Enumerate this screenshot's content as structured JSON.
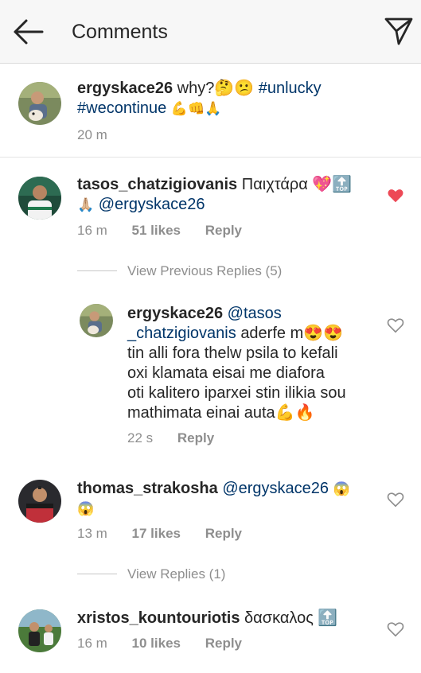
{
  "header": {
    "title": "Comments",
    "back_icon": "arrow-left-icon",
    "send_icon": "paper-plane-icon"
  },
  "caption": {
    "username": "ergyskace26",
    "text": "why?🤔😕",
    "hashtag1": "#unlucky",
    "hashtag2": "#wecontinue",
    "emojis": "💪👊🙏",
    "time": "20 m"
  },
  "comments": [
    {
      "username": "tasos_chatzigiovanis",
      "text": "Παιχτάρα 💖🔝",
      "emoji_line": "🙏🏼",
      "mention": "@ergyskace26",
      "time": "16 m",
      "likes": "51 likes",
      "reply": "Reply",
      "liked": true
    },
    {
      "username": "thomas_strakosha",
      "mention": "@ergyskace26",
      "text": "😱",
      "text2": "😱",
      "time": "13 m",
      "likes": "17 likes",
      "reply": "Reply",
      "liked": false
    },
    {
      "username": "xristos_kountouriotis",
      "text": "δασκαλος 🔝",
      "time": "16 m",
      "likes": "10 likes",
      "reply": "Reply",
      "liked": false
    }
  ],
  "view_previous": "View Previous Replies (5)",
  "reply1": {
    "username": "ergyskace26",
    "mention_a": "@tasos",
    "mention_b": "_chatzigiovanis",
    "line1_rest": "aderfe m😍😍",
    "line2": "tin alli fora thelw psila to kefali",
    "line3": "oxi klamata eisai me diafora",
    "line4": "oti kalitero iparxei stin ilikia sou",
    "line5": "mathimata einai auta💪🔥",
    "time": "22 s",
    "reply": "Reply"
  },
  "view_replies": "View Replies (1)",
  "colors": {
    "liked_heart": "#ed4956",
    "mention": "#003569",
    "meta": "#8e8e8e"
  }
}
